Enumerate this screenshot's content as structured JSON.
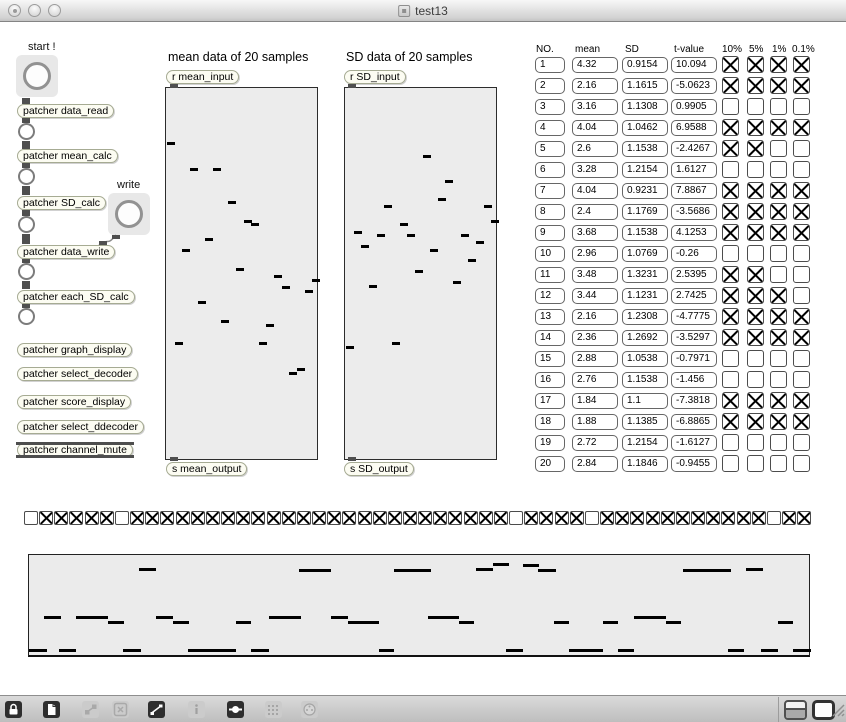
{
  "window": {
    "title": "test13"
  },
  "labels": {
    "start": "start !",
    "write": "write",
    "mean_graph_title": "mean data of 20 samples",
    "sd_graph_title": "SD data of 20 samples"
  },
  "objects": {
    "data_read": "patcher data_read",
    "mean_calc": "patcher mean_calc",
    "sd_calc": "patcher SD_calc",
    "data_write": "patcher data_write",
    "each_sd_calc": "patcher each_SD_calc",
    "graph_display": "patcher graph_display",
    "select_decoder": "patcher select_decoder",
    "score_display": "patcher score_display",
    "select_ddecoder": "patcher select_ddecoder",
    "channel_mute": "patcher channel_mute",
    "r_mean_input": "r mean_input",
    "s_mean_output": "s mean_output",
    "r_sd_input": "r SD_input",
    "s_sd_output": "s SD_output"
  },
  "table": {
    "headers": [
      "NO.",
      "mean",
      "SD",
      "t-value",
      "10%",
      "5%",
      "1%",
      "0.1%"
    ],
    "rows": [
      {
        "no": "1",
        "mean": "4.32",
        "sd": "0.9154",
        "t": "10.094",
        "checks": [
          1,
          1,
          1,
          1
        ]
      },
      {
        "no": "2",
        "mean": "2.16",
        "sd": "1.1615",
        "t": "-5.0623",
        "checks": [
          1,
          1,
          1,
          1
        ]
      },
      {
        "no": "3",
        "mean": "3.16",
        "sd": "1.1308",
        "t": "0.9905",
        "checks": [
          0,
          0,
          0,
          0
        ]
      },
      {
        "no": "4",
        "mean": "4.04",
        "sd": "1.0462",
        "t": "6.9588",
        "checks": [
          1,
          1,
          1,
          1
        ]
      },
      {
        "no": "5",
        "mean": "2.6",
        "sd": "1.1538",
        "t": "-2.4267",
        "checks": [
          1,
          1,
          0,
          0
        ]
      },
      {
        "no": "6",
        "mean": "3.28",
        "sd": "1.2154",
        "t": "1.6127",
        "checks": [
          0,
          0,
          0,
          0
        ]
      },
      {
        "no": "7",
        "mean": "4.04",
        "sd": "0.9231",
        "t": "7.8867",
        "checks": [
          1,
          1,
          1,
          1
        ]
      },
      {
        "no": "8",
        "mean": "2.4",
        "sd": "1.1769",
        "t": "-3.5686",
        "checks": [
          1,
          1,
          1,
          1
        ]
      },
      {
        "no": "9",
        "mean": "3.68",
        "sd": "1.1538",
        "t": "4.1253",
        "checks": [
          1,
          1,
          1,
          1
        ]
      },
      {
        "no": "10",
        "mean": "2.96",
        "sd": "1.0769",
        "t": "-0.26",
        "checks": [
          0,
          0,
          0,
          0
        ]
      },
      {
        "no": "11",
        "mean": "3.48",
        "sd": "1.3231",
        "t": "2.5395",
        "checks": [
          1,
          1,
          0,
          0
        ]
      },
      {
        "no": "12",
        "mean": "3.44",
        "sd": "1.1231",
        "t": "2.7425",
        "checks": [
          1,
          1,
          1,
          0
        ]
      },
      {
        "no": "13",
        "mean": "2.16",
        "sd": "1.2308",
        "t": "-4.7775",
        "checks": [
          1,
          1,
          1,
          1
        ]
      },
      {
        "no": "14",
        "mean": "2.36",
        "sd": "1.2692",
        "t": "-3.5297",
        "checks": [
          1,
          1,
          1,
          1
        ]
      },
      {
        "no": "15",
        "mean": "2.88",
        "sd": "1.0538",
        "t": "-0.7971",
        "checks": [
          0,
          0,
          0,
          0
        ]
      },
      {
        "no": "16",
        "mean": "2.76",
        "sd": "1.1538",
        "t": "-1.456",
        "checks": [
          0,
          0,
          0,
          0
        ]
      },
      {
        "no": "17",
        "mean": "1.84",
        "sd": "1.1",
        "t": "-7.3818",
        "checks": [
          1,
          1,
          1,
          1
        ]
      },
      {
        "no": "18",
        "mean": "1.88",
        "sd": "1.1385",
        "t": "-6.8865",
        "checks": [
          1,
          1,
          1,
          1
        ]
      },
      {
        "no": "19",
        "mean": "2.72",
        "sd": "1.2154",
        "t": "-1.6127",
        "checks": [
          0,
          0,
          0,
          0
        ]
      },
      {
        "no": "20",
        "mean": "2.84",
        "sd": "1.1846",
        "t": "-0.9455",
        "checks": [
          0,
          0,
          0,
          0
        ]
      }
    ]
  },
  "mute_row": {
    "states": [
      0,
      1,
      1,
      1,
      1,
      1,
      0,
      1,
      1,
      1,
      1,
      1,
      1,
      1,
      1,
      1,
      1,
      1,
      1,
      1,
      1,
      1,
      1,
      1,
      1,
      1,
      1,
      1,
      1,
      1,
      1,
      1,
      0,
      1,
      1,
      1,
      1,
      0,
      1,
      1,
      1,
      1,
      1,
      1,
      1,
      1,
      1,
      1,
      1,
      0,
      1,
      1
    ]
  },
  "score": {
    "notes": [
      [
        110,
        17,
        13
      ],
      [
        270,
        32,
        14
      ],
      [
        365,
        37,
        14
      ],
      [
        447,
        17,
        13
      ],
      [
        464,
        16,
        8
      ],
      [
        494,
        16,
        9
      ],
      [
        509,
        18,
        14
      ],
      [
        654,
        48,
        14
      ],
      [
        717,
        17,
        13
      ],
      [
        15,
        17,
        61
      ],
      [
        47,
        32,
        61
      ],
      [
        79,
        16,
        66
      ],
      [
        127,
        17,
        61
      ],
      [
        144,
        16,
        66
      ],
      [
        207,
        15,
        66
      ],
      [
        240,
        32,
        61
      ],
      [
        302,
        17,
        61
      ],
      [
        319,
        31,
        66
      ],
      [
        399,
        31,
        61
      ],
      [
        430,
        15,
        66
      ],
      [
        525,
        15,
        66
      ],
      [
        574,
        15,
        66
      ],
      [
        605,
        32,
        61
      ],
      [
        637,
        15,
        66
      ],
      [
        749,
        15,
        66
      ],
      [
        0,
        18,
        94
      ],
      [
        30,
        17,
        94
      ],
      [
        94,
        18,
        94
      ],
      [
        159,
        48,
        94
      ],
      [
        222,
        18,
        94
      ],
      [
        350,
        15,
        94
      ],
      [
        477,
        17,
        94
      ],
      [
        540,
        34,
        94
      ],
      [
        589,
        16,
        94
      ],
      [
        699,
        16,
        94
      ],
      [
        732,
        17,
        94
      ],
      [
        764,
        18,
        94
      ]
    ]
  },
  "toolbar": {
    "icons": [
      {
        "name": "lock-icon",
        "disabled": false
      },
      {
        "name": "new-object-icon",
        "disabled": false
      },
      {
        "name": "patch-cords-icon",
        "disabled": true
      },
      {
        "name": "close-box-icon",
        "disabled": true
      },
      {
        "name": "graph-icon",
        "disabled": false
      },
      {
        "name": "info-icon",
        "disabled": true
      },
      {
        "name": "connector-icon",
        "disabled": false
      },
      {
        "name": "grid-icon",
        "disabled": true
      },
      {
        "name": "timer-icon",
        "disabled": true
      }
    ],
    "right_icons": [
      "split-window-icon",
      "window-icon",
      "resize-grip-icon"
    ]
  }
}
